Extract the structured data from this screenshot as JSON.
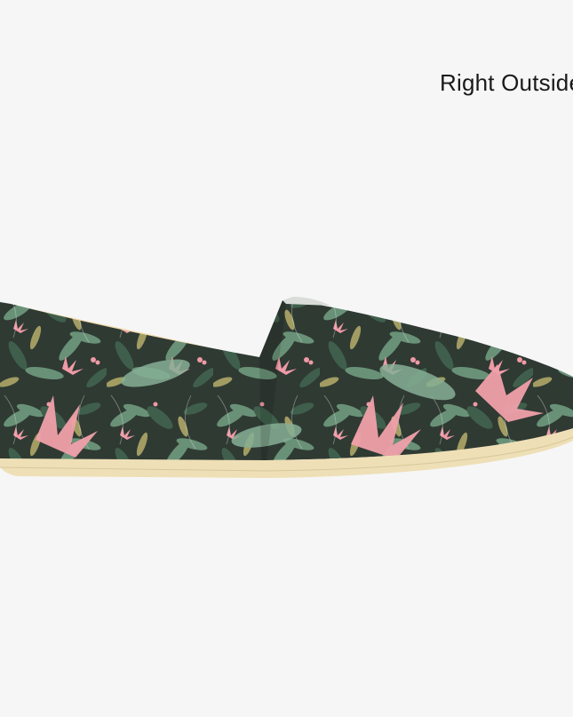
{
  "view": {
    "label": "Right Outside"
  },
  "product": {
    "image_name": "slip-on-canvas-shoe",
    "pattern": "tropical-jungle-floral",
    "colors": {
      "background": "#f6f6f6",
      "pattern_base": "#2f3a33",
      "leaf_green": "#6f9a7e",
      "leaf_dark": "#3f5f4c",
      "leaf_olive": "#b6ad6a",
      "flower_pink": "#ef9aa6",
      "sole": "#eedfb6",
      "lining": "#f2ddb0"
    }
  }
}
